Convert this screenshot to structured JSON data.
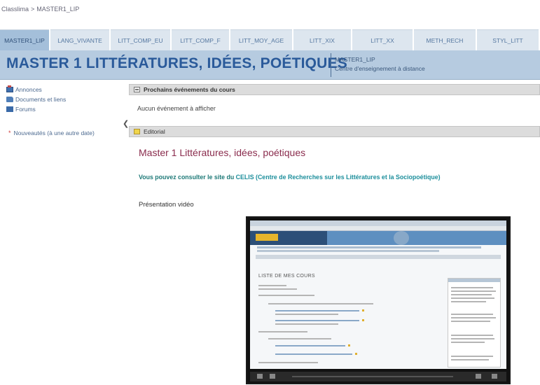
{
  "breadcrumb": {
    "root": "Classlima",
    "separator": ">",
    "current": "MASTER1_LIP"
  },
  "tabs": [
    {
      "label": "MASTER1_LIP",
      "active": true
    },
    {
      "label": "LANG_VIVANTE",
      "active": false
    },
    {
      "label": "LITT_COMP_EU",
      "active": false
    },
    {
      "label": "LITT_COMP_F",
      "active": false
    },
    {
      "label": "LITT_MOY_AGE",
      "active": false
    },
    {
      "label": "LITT_XIX",
      "active": false
    },
    {
      "label": "LITT_XX",
      "active": false
    },
    {
      "label": "METH_RECH",
      "active": false
    },
    {
      "label": "STYL_LITT",
      "active": false
    }
  ],
  "course": {
    "title": "MASTER 1 LITTÉRATURES, IDÉES, POÉTIQUES",
    "code": "MASTER1_LIP",
    "subtitle": "Centre d'enseignement à distance"
  },
  "sidebar": {
    "items": [
      {
        "label": "Annonces",
        "icon": "announcement-icon"
      },
      {
        "label": "Documents et liens",
        "icon": "folder-icon"
      },
      {
        "label": "Forums",
        "icon": "forum-icon"
      }
    ],
    "news": "Nouveautés (à une autre date)"
  },
  "events": {
    "heading": "Prochains événements du cours",
    "empty": "Aucun événement à afficher"
  },
  "editorial": {
    "heading": "Editorial",
    "title": "Master 1 Littératures, idées, poétiques",
    "celis_prefix": "Vous pouvez consulter le site du ",
    "celis_link": "CELIS (Centre de Recherches sur les Littératures et la Sociopoétique)",
    "video_label": "Présentation vidéo"
  },
  "video": {
    "screen_title": "LISTE DE MES COURS"
  },
  "colors": {
    "banner": "#b6cbe0",
    "title": "#2a5a9a",
    "editorial_title": "#8a2c4d",
    "link": "#1d8f9c"
  }
}
